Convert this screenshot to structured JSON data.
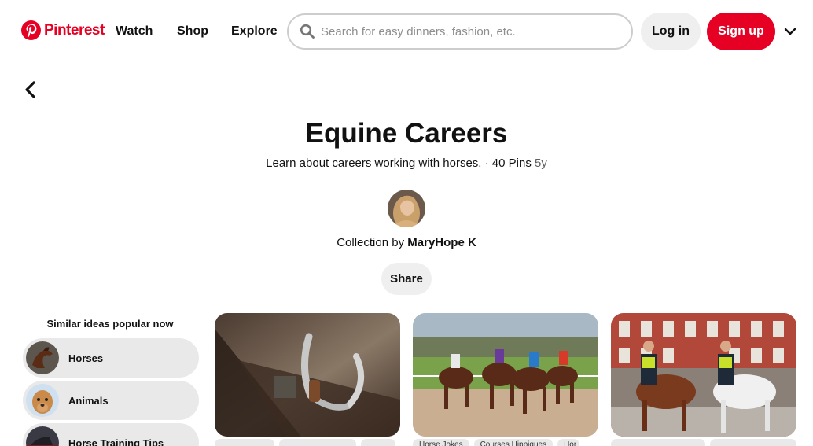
{
  "header": {
    "brand": "Pinterest",
    "nav": [
      "Watch",
      "Shop",
      "Explore"
    ],
    "search_placeholder": "Search for easy dinners, fashion, etc.",
    "login_label": "Log in",
    "signup_label": "Sign up"
  },
  "board": {
    "title": "Equine Careers",
    "description": "Learn about careers working with horses.",
    "separator": " · ",
    "pin_count": "40 Pins",
    "age": "5y",
    "collection_prefix": "Collection by",
    "owner": "MaryHope K",
    "share_label": "Share"
  },
  "similar": {
    "heading": "Similar ideas popular now",
    "items": [
      {
        "label": "Horses"
      },
      {
        "label": "Animals"
      },
      {
        "label": "Horse Training Tips"
      }
    ]
  },
  "pins": {
    "pin2_tags": [
      "Horse Jokes",
      "Courses Hippiques",
      "Hor"
    ]
  },
  "colors": {
    "brand_red": "#e60023",
    "button_gray": "#efefef",
    "chip_gray": "#e9e9e9"
  }
}
